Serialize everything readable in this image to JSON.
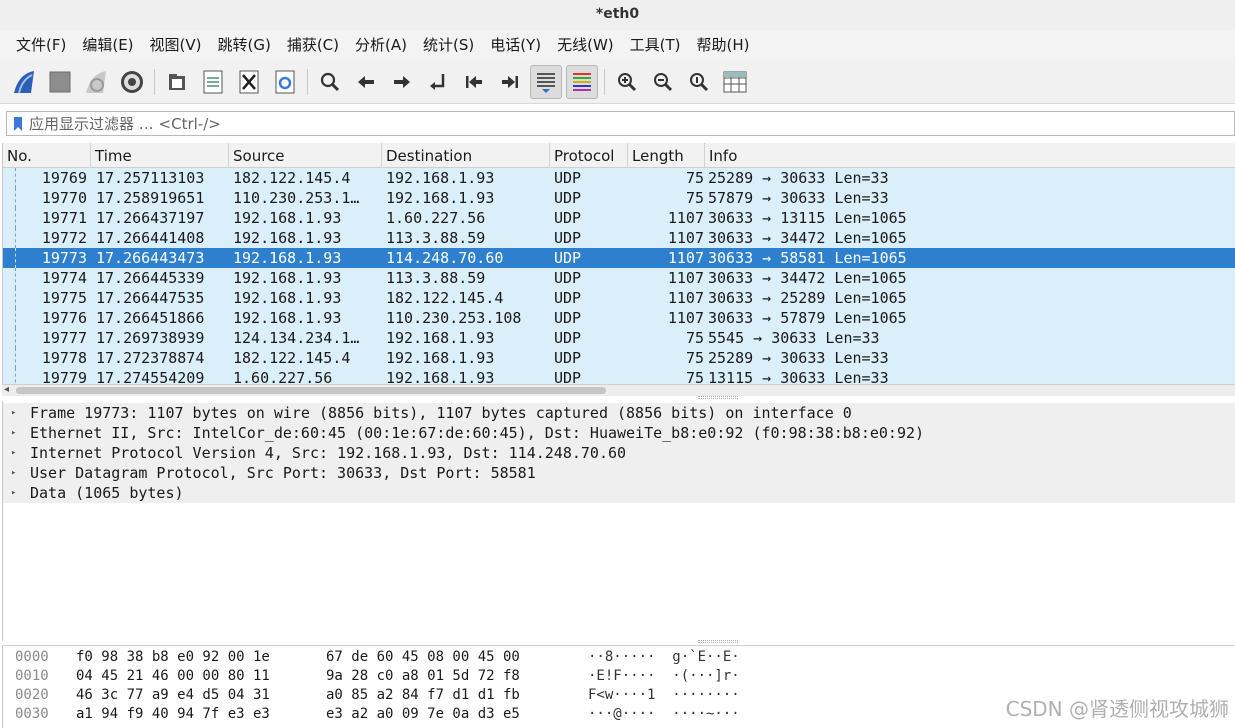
{
  "window": {
    "title": "*eth0"
  },
  "menu": [
    "文件(F)",
    "编辑(E)",
    "视图(V)",
    "跳转(G)",
    "捕获(C)",
    "分析(A)",
    "统计(S)",
    "电话(Y)",
    "无线(W)",
    "工具(T)",
    "帮助(H)"
  ],
  "toolbar": {
    "icons": [
      "shark-fin-start-icon",
      "stop-square-icon",
      "restart-fin-icon",
      "options-gear-icon",
      "open-folder-icon",
      "save-file-icon",
      "close-file-icon",
      "reload-icon",
      "find-icon",
      "go-back-icon",
      "go-forward-icon",
      "go-to-packet-icon",
      "first-packet-icon",
      "last-packet-icon",
      "autoscroll-icon",
      "colorize-icon",
      "zoom-in-icon",
      "zoom-out-icon",
      "normal-size-icon",
      "resize-columns-icon"
    ]
  },
  "filter": {
    "placeholder": "应用显示过滤器 … <Ctrl-/>"
  },
  "packet_list": {
    "columns": [
      "No.",
      "Time",
      "Source",
      "Destination",
      "Protocol",
      "Length",
      "Info"
    ],
    "rows": [
      {
        "no": "19769",
        "time": "17.257113103",
        "src": "182.122.145.4",
        "dst": "192.168.1.93",
        "proto": "UDP",
        "len": "75",
        "info": "25289 → 30633 Len=33"
      },
      {
        "no": "19770",
        "time": "17.258919651",
        "src": "110.230.253.1…",
        "dst": "192.168.1.93",
        "proto": "UDP",
        "len": "75",
        "info": "57879 → 30633 Len=33"
      },
      {
        "no": "19771",
        "time": "17.266437197",
        "src": "192.168.1.93",
        "dst": "1.60.227.56",
        "proto": "UDP",
        "len": "1107",
        "info": "30633 → 13115 Len=1065"
      },
      {
        "no": "19772",
        "time": "17.266441408",
        "src": "192.168.1.93",
        "dst": "113.3.88.59",
        "proto": "UDP",
        "len": "1107",
        "info": "30633 → 34472 Len=1065"
      },
      {
        "no": "19773",
        "time": "17.266443473",
        "src": "192.168.1.93",
        "dst": "114.248.70.60",
        "proto": "UDP",
        "len": "1107",
        "info": "30633 → 58581 Len=1065"
      },
      {
        "no": "19774",
        "time": "17.266445339",
        "src": "192.168.1.93",
        "dst": "113.3.88.59",
        "proto": "UDP",
        "len": "1107",
        "info": "30633 → 34472 Len=1065"
      },
      {
        "no": "19775",
        "time": "17.266447535",
        "src": "192.168.1.93",
        "dst": "182.122.145.4",
        "proto": "UDP",
        "len": "1107",
        "info": "30633 → 25289 Len=1065"
      },
      {
        "no": "19776",
        "time": "17.266451866",
        "src": "192.168.1.93",
        "dst": "110.230.253.108",
        "proto": "UDP",
        "len": "1107",
        "info": "30633 → 57879 Len=1065"
      },
      {
        "no": "19777",
        "time": "17.269738939",
        "src": "124.134.234.1…",
        "dst": "192.168.1.93",
        "proto": "UDP",
        "len": "75",
        "info": "5545 → 30633 Len=33"
      },
      {
        "no": "19778",
        "time": "17.272378874",
        "src": "182.122.145.4",
        "dst": "192.168.1.93",
        "proto": "UDP",
        "len": "75",
        "info": "25289 → 30633 Len=33"
      },
      {
        "no": "19779",
        "time": "17.274554209",
        "src": "1.60.227.56",
        "dst": "192.168.1.93",
        "proto": "UDP",
        "len": "75",
        "info": "13115 → 30633 Len=33"
      }
    ]
  },
  "details": [
    "Frame 19773: 1107 bytes on wire (8856 bits), 1107 bytes captured (8856 bits) on interface 0",
    "Ethernet II, Src: IntelCor_de:60:45 (00:1e:67:de:60:45), Dst: HuaweiTe_b8:e0:92 (f0:98:38:b8:e0:92)",
    "Internet Protocol Version 4, Src: 192.168.1.93, Dst: 114.248.70.60",
    "User Datagram Protocol, Src Port: 30633, Dst Port: 58581",
    "Data (1065 bytes)"
  ],
  "hex": [
    {
      "offset": "0000",
      "b1": "f0 98 38 b8 e0 92 00 1e",
      "b2": "67 de 60 45 08 00 45 00",
      "ascii": "··8·····  g·`E··E·"
    },
    {
      "offset": "0010",
      "b1": "04 45 21 46 00 00 80 11",
      "b2": "9a 28 c0 a8 01 5d 72 f8",
      "ascii": "·E!F····  ·(···]r·"
    },
    {
      "offset": "0020",
      "b1": "46 3c 77 a9 e4 d5 04 31",
      "b2": "a0 85 a2 84 f7 d1 d1 fb",
      "ascii": "F<w····1  ········"
    },
    {
      "offset": "0030",
      "b1": "a1 94 f9 40 94 7f e3 e3",
      "b2": "e3 a2 a0 09 7e 0a d3 e5",
      "ascii": "···@····  ····~···"
    }
  ],
  "watermark": "CSDN @肾透侧视攻城狮",
  "colors": {
    "row_bg": "#dbeffb",
    "selected_bg": "#2f7fcf",
    "detail_bg": "#efefef"
  }
}
